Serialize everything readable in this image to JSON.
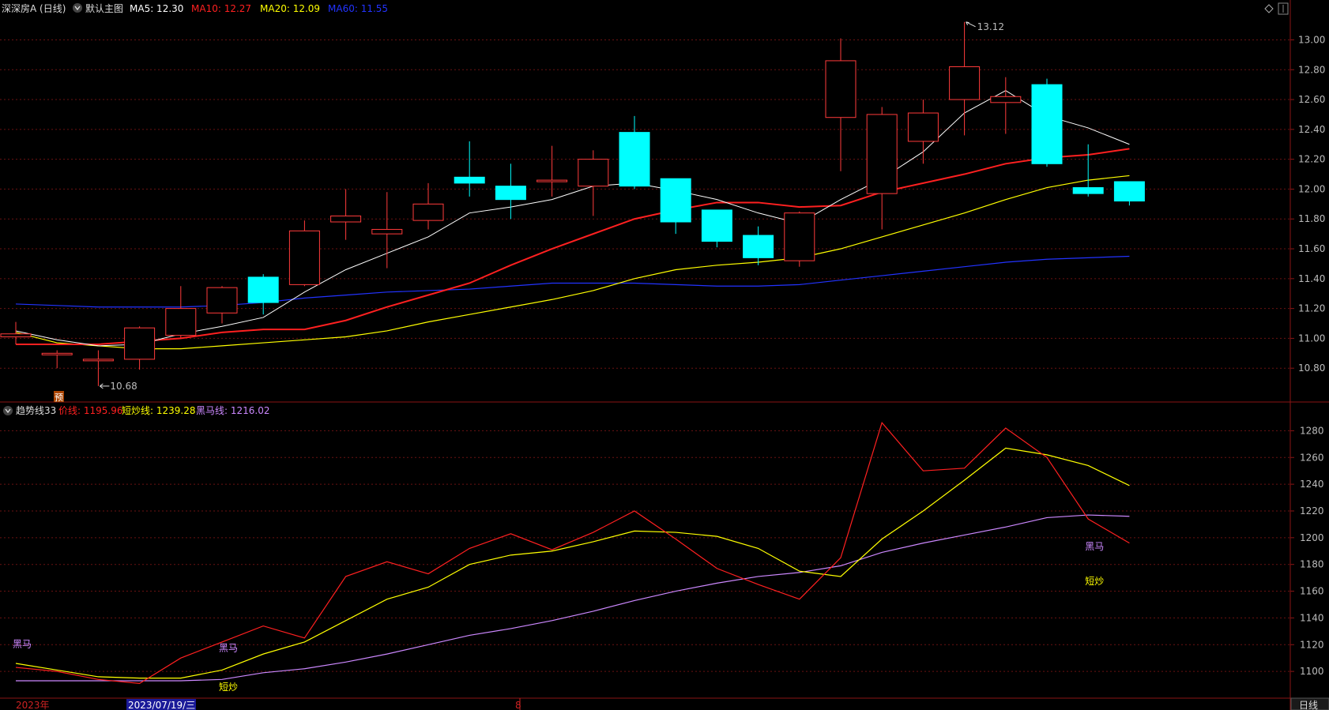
{
  "header": {
    "title": "深深房A (日线)",
    "main_label": "默认主图",
    "ma5": {
      "label": "MA5: 12.30",
      "color": "#ffffff"
    },
    "ma10": {
      "label": "MA10: 12.27",
      "color": "#ff2020"
    },
    "ma20": {
      "label": "MA20: 12.09",
      "color": "#ffff00"
    },
    "ma60": {
      "label": "MA60: 11.55",
      "color": "#2233ff"
    }
  },
  "sub_header": {
    "title": "趋势线33",
    "price_line": {
      "label": "价线: 1195.96",
      "color": "#ff2020"
    },
    "short_line": {
      "label": "短炒线: 1239.28",
      "color": "#ffff00"
    },
    "horse_line": {
      "label": "黑马线: 1216.02",
      "color": "#cc88ff"
    }
  },
  "annotations": {
    "high": "13.12",
    "low": "10.68",
    "yu_badge": "预",
    "sub_labels": [
      {
        "text": "黑马",
        "i": 0,
        "v": 1118,
        "color": "#cc88ff"
      },
      {
        "text": "黑马",
        "i": 5,
        "v": 1115,
        "color": "#cc88ff"
      },
      {
        "text": "短炒",
        "i": 5,
        "v": 1086,
        "color": "#ffff00"
      },
      {
        "text": "黑马",
        "i": 26,
        "v": 1191,
        "color": "#cc88ff"
      },
      {
        "text": "短炒",
        "i": 26,
        "v": 1165,
        "color": "#ffff00"
      }
    ]
  },
  "bottom_bar": {
    "year": "2023年",
    "date_cursor": "2023/07/19/三",
    "month_mark": "8",
    "period_button": "日线"
  },
  "chart_data": [
    {
      "type": "candlestick",
      "name": "main",
      "ylim": [
        10.6,
        13.14
      ],
      "yticks": [
        10.8,
        11.0,
        11.2,
        11.4,
        11.6,
        11.8,
        12.0,
        12.2,
        12.4,
        12.6,
        12.8,
        13.0
      ],
      "candles": [
        {
          "o": 11.01,
          "h": 11.11,
          "l": 10.96,
          "c": 11.03
        },
        {
          "o": 10.89,
          "h": 10.92,
          "l": 10.8,
          "c": 10.9
        },
        {
          "o": 10.85,
          "h": 10.92,
          "l": 10.68,
          "c": 10.86
        },
        {
          "o": 10.86,
          "h": 11.08,
          "l": 10.79,
          "c": 11.07
        },
        {
          "o": 11.02,
          "h": 11.35,
          "l": 11.0,
          "c": 11.2
        },
        {
          "o": 11.17,
          "h": 11.35,
          "l": 11.1,
          "c": 11.34
        },
        {
          "o": 11.41,
          "h": 11.43,
          "l": 11.16,
          "c": 11.24
        },
        {
          "o": 11.36,
          "h": 11.79,
          "l": 11.35,
          "c": 11.72
        },
        {
          "o": 11.78,
          "h": 12.0,
          "l": 11.66,
          "c": 11.82
        },
        {
          "o": 11.7,
          "h": 11.98,
          "l": 11.47,
          "c": 11.73
        },
        {
          "o": 11.79,
          "h": 12.04,
          "l": 11.73,
          "c": 11.9
        },
        {
          "o": 12.08,
          "h": 12.32,
          "l": 11.95,
          "c": 12.04
        },
        {
          "o": 12.02,
          "h": 12.17,
          "l": 11.8,
          "c": 11.93
        },
        {
          "o": 12.05,
          "h": 12.29,
          "l": 11.95,
          "c": 12.06
        },
        {
          "o": 12.02,
          "h": 12.26,
          "l": 11.82,
          "c": 12.2
        },
        {
          "o": 12.38,
          "h": 12.49,
          "l": 12.0,
          "c": 12.02
        },
        {
          "o": 12.07,
          "h": 12.07,
          "l": 11.7,
          "c": 11.78
        },
        {
          "o": 11.86,
          "h": 11.86,
          "l": 11.61,
          "c": 11.65
        },
        {
          "o": 11.69,
          "h": 11.75,
          "l": 11.49,
          "c": 11.54
        },
        {
          "o": 11.52,
          "h": 11.85,
          "l": 11.48,
          "c": 11.84
        },
        {
          "o": 12.48,
          "h": 13.01,
          "l": 12.12,
          "c": 12.86
        },
        {
          "o": 11.97,
          "h": 12.55,
          "l": 11.73,
          "c": 12.5
        },
        {
          "o": 12.32,
          "h": 12.6,
          "l": 12.17,
          "c": 12.51
        },
        {
          "o": 12.6,
          "h": 13.12,
          "l": 12.36,
          "c": 12.82
        },
        {
          "o": 12.58,
          "h": 12.75,
          "l": 12.37,
          "c": 12.62
        },
        {
          "o": 12.7,
          "h": 12.74,
          "l": 12.15,
          "c": 12.17
        },
        {
          "o": 12.01,
          "h": 12.3,
          "l": 11.95,
          "c": 11.97
        },
        {
          "o": 12.05,
          "h": 12.05,
          "l": 11.89,
          "c": 11.92
        }
      ],
      "ma5": [
        11.05,
        10.99,
        10.95,
        10.96,
        11.03,
        11.08,
        11.14,
        11.31,
        11.46,
        11.57,
        11.68,
        11.84,
        11.88,
        11.93,
        12.02,
        12.04,
        11.99,
        11.93,
        11.84,
        11.77,
        11.93,
        12.07,
        12.25,
        12.51,
        12.66,
        12.49,
        12.41,
        12.3
      ],
      "ma10": [
        10.96,
        10.96,
        10.96,
        10.98,
        11.0,
        11.04,
        11.06,
        11.06,
        11.12,
        11.21,
        11.29,
        11.37,
        11.49,
        11.6,
        11.7,
        11.8,
        11.86,
        11.91,
        11.91,
        11.88,
        11.89,
        11.98,
        12.04,
        12.1,
        12.17,
        12.21,
        12.23,
        12.27
      ],
      "ma20": [
        11.04,
        10.97,
        10.95,
        10.93,
        10.93,
        10.95,
        10.97,
        10.99,
        11.01,
        11.05,
        11.11,
        11.16,
        11.21,
        11.26,
        11.32,
        11.4,
        11.46,
        11.49,
        11.51,
        11.54,
        11.6,
        11.68,
        11.76,
        11.84,
        11.93,
        12.01,
        12.06,
        12.09
      ],
      "ma60": [
        11.23,
        11.22,
        11.21,
        11.21,
        11.21,
        11.22,
        11.24,
        11.27,
        11.29,
        11.31,
        11.32,
        11.33,
        11.35,
        11.37,
        11.37,
        11.37,
        11.36,
        11.35,
        11.35,
        11.36,
        11.39,
        11.42,
        11.45,
        11.48,
        11.51,
        11.53,
        11.54,
        11.55
      ]
    },
    {
      "type": "line",
      "name": "sub",
      "ylim": [
        1080,
        1295
      ],
      "yticks": [
        1100,
        1120,
        1140,
        1160,
        1180,
        1200,
        1220,
        1240,
        1260,
        1280
      ],
      "series": [
        {
          "name": "价线",
          "color": "#ff2020",
          "values": [
            1103,
            1100,
            1094,
            1091,
            1110,
            1122,
            1134,
            1125,
            1171,
            1182,
            1173,
            1192,
            1203,
            1191,
            1204,
            1220,
            1199,
            1177,
            1165,
            1154,
            1185,
            1286,
            1250,
            1252,
            1282,
            1260,
            1214,
            1196
          ]
        },
        {
          "name": "短炒线",
          "color": "#ffff00",
          "values": [
            1106,
            1101,
            1096,
            1095,
            1095,
            1101,
            1113,
            1122,
            1138,
            1154,
            1163,
            1180,
            1187,
            1190,
            1197,
            1205,
            1204,
            1201,
            1192,
            1175,
            1171,
            1199,
            1220,
            1243,
            1267,
            1262,
            1254,
            1239
          ]
        },
        {
          "name": "黑马线",
          "color": "#cc88ff",
          "values": [
            1093,
            1093,
            1093,
            1093,
            1093,
            1094,
            1099,
            1102,
            1107,
            1113,
            1120,
            1127,
            1132,
            1138,
            1145,
            1153,
            1160,
            1166,
            1171,
            1174,
            1179,
            1189,
            1196,
            1202,
            1208,
            1215,
            1217,
            1216
          ]
        }
      ]
    }
  ]
}
